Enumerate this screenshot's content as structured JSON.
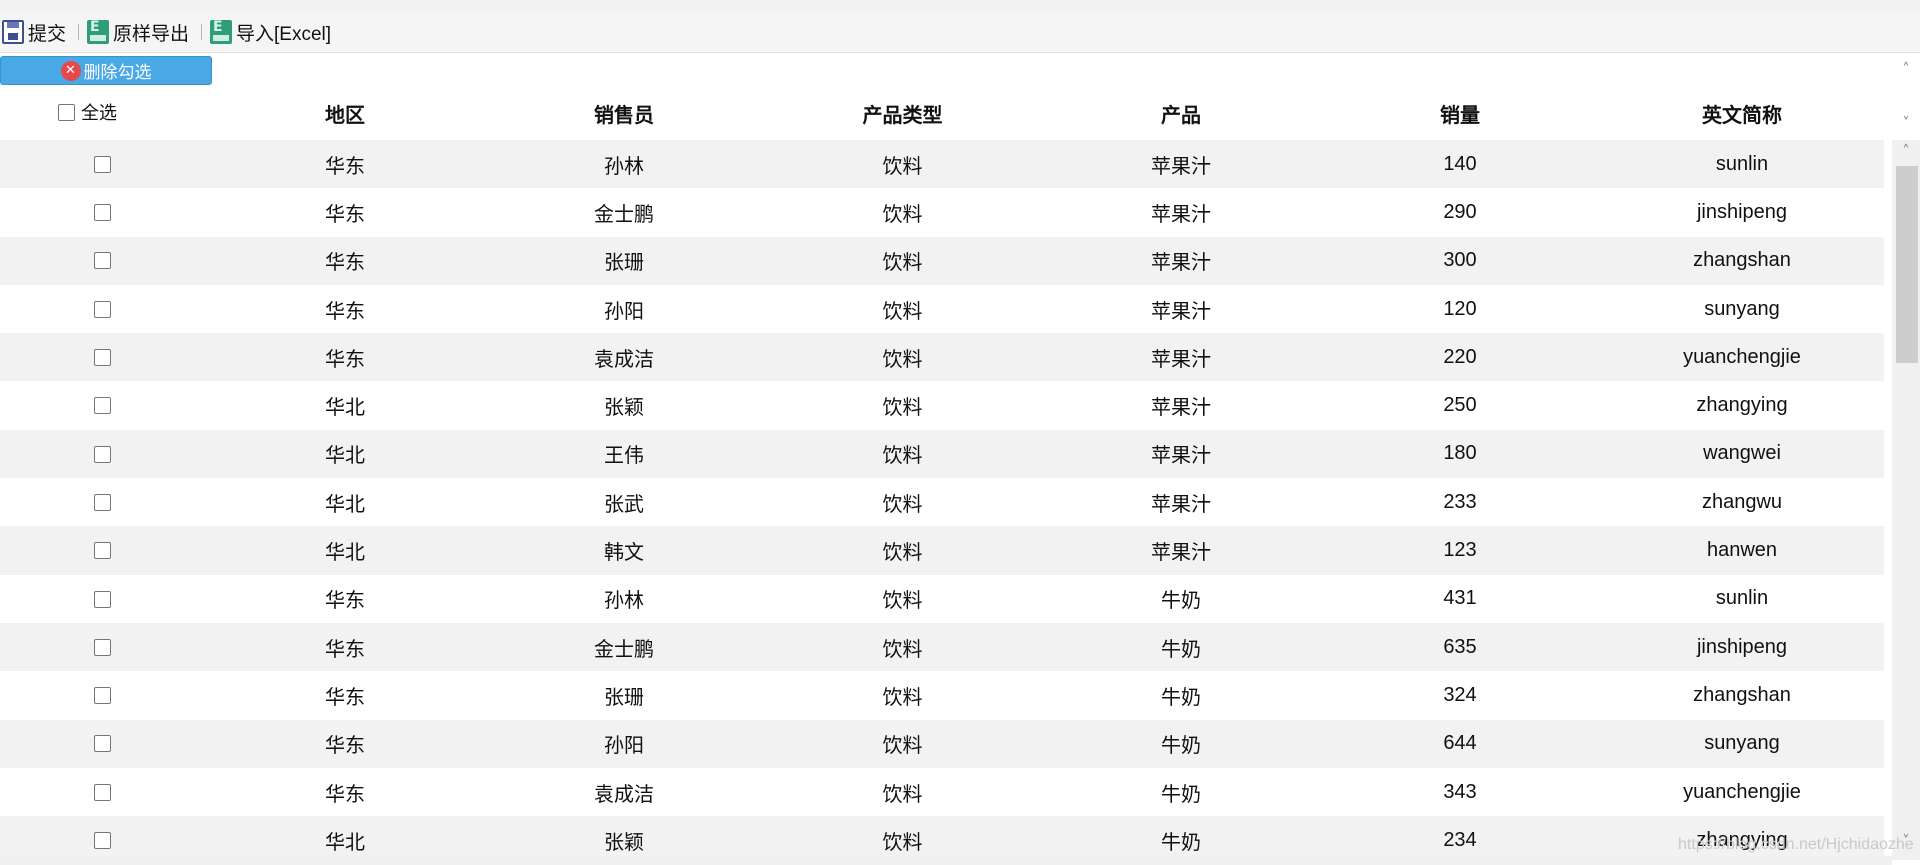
{
  "toolbar": {
    "submit_label": "提交",
    "export_label": "原样导出",
    "import_label": "导入[Excel]"
  },
  "delete_button_label": "删除勾选",
  "select_all_label": "全选",
  "columns": [
    "地区",
    "销售员",
    "产品类型",
    "产品",
    "销量",
    "英文简称"
  ],
  "rows": [
    {
      "region": "华东",
      "salesperson": "孙林",
      "category": "饮料",
      "product": "苹果汁",
      "sales": "140",
      "english": "sunlin"
    },
    {
      "region": "华东",
      "salesperson": "金士鹏",
      "category": "饮料",
      "product": "苹果汁",
      "sales": "290",
      "english": "jinshipeng"
    },
    {
      "region": "华东",
      "salesperson": "张珊",
      "category": "饮料",
      "product": "苹果汁",
      "sales": "300",
      "english": "zhangshan"
    },
    {
      "region": "华东",
      "salesperson": "孙阳",
      "category": "饮料",
      "product": "苹果汁",
      "sales": "120",
      "english": "sunyang"
    },
    {
      "region": "华东",
      "salesperson": "袁成洁",
      "category": "饮料",
      "product": "苹果汁",
      "sales": "220",
      "english": "yuanchengjie"
    },
    {
      "region": "华北",
      "salesperson": "张颖",
      "category": "饮料",
      "product": "苹果汁",
      "sales": "250",
      "english": "zhangying"
    },
    {
      "region": "华北",
      "salesperson": "王伟",
      "category": "饮料",
      "product": "苹果汁",
      "sales": "180",
      "english": "wangwei"
    },
    {
      "region": "华北",
      "salesperson": "张武",
      "category": "饮料",
      "product": "苹果汁",
      "sales": "233",
      "english": "zhangwu"
    },
    {
      "region": "华北",
      "salesperson": "韩文",
      "category": "饮料",
      "product": "苹果汁",
      "sales": "123",
      "english": "hanwen"
    },
    {
      "region": "华东",
      "salesperson": "孙林",
      "category": "饮料",
      "product": "牛奶",
      "sales": "431",
      "english": "sunlin"
    },
    {
      "region": "华东",
      "salesperson": "金士鹏",
      "category": "饮料",
      "product": "牛奶",
      "sales": "635",
      "english": "jinshipeng"
    },
    {
      "region": "华东",
      "salesperson": "张珊",
      "category": "饮料",
      "product": "牛奶",
      "sales": "324",
      "english": "zhangshan"
    },
    {
      "region": "华东",
      "salesperson": "孙阳",
      "category": "饮料",
      "product": "牛奶",
      "sales": "644",
      "english": "sunyang"
    },
    {
      "region": "华东",
      "salesperson": "袁成洁",
      "category": "饮料",
      "product": "牛奶",
      "sales": "343",
      "english": "yuanchengjie"
    },
    {
      "region": "华北",
      "salesperson": "张颖",
      "category": "饮料",
      "product": "牛奶",
      "sales": "234",
      "english": "zhangying"
    }
  ],
  "scrollbar": {
    "up_arrow": "˄",
    "down_arrow": "˅"
  },
  "watermark": "https://blog.csdn.net/Hjchidaozhe"
}
